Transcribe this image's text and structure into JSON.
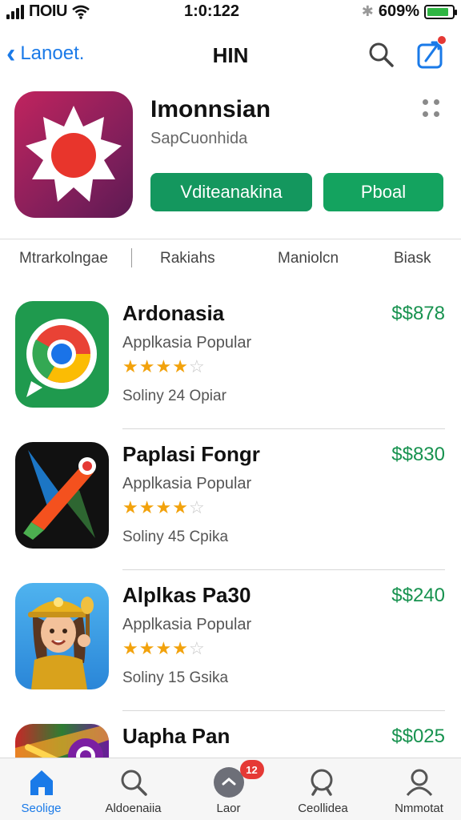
{
  "status_bar": {
    "carrier": "ПОIU",
    "time": "1:0:122",
    "battery_percent": "609%",
    "battery_level": 0.85,
    "icons": [
      "signal-icon",
      "wifi-icon",
      "bluetooth-icon",
      "battery-icon"
    ]
  },
  "nav": {
    "back_label": "Lanoet.",
    "title": "HIN",
    "icons": [
      "back-chevron-icon",
      "search-icon",
      "share-icon"
    ]
  },
  "app": {
    "name": "Imonnsian",
    "developer": "SapCuonhida",
    "primary_button": "Vditeanakina",
    "secondary_button": "Pboal",
    "accent": "#14975e"
  },
  "tabs": [
    {
      "label": "Mtrarkolngae"
    },
    {
      "label": "Rakiahs"
    },
    {
      "label": "Maniolcn"
    },
    {
      "label": "Biask"
    }
  ],
  "list": [
    {
      "title": "Ardonasia",
      "subtitle": "Applkasia Popular",
      "rating": 4,
      "meta": "Soliny 24 Opiar",
      "price": "$$878",
      "icon": "chrome-like-app-icon"
    },
    {
      "title": "Paplasi Fongr",
      "subtitle": "Applkasia Popular",
      "rating": 4,
      "meta": "Soliny 45 Cpika",
      "price": "$$830",
      "icon": "paint-brush-app-icon"
    },
    {
      "title": "Alplkas Pa30",
      "subtitle": "Applkasia Popular",
      "rating": 4,
      "meta": "Soliny 15 Gsika",
      "price": "$$240",
      "icon": "explorer-character-app-icon"
    },
    {
      "title": "Uapha Pan",
      "subtitle": "",
      "rating": 0,
      "meta": "",
      "price": "$$025",
      "icon": "colorful-app-icon"
    }
  ],
  "tab_bar": {
    "items": [
      {
        "label": "Seolige",
        "icon": "home-icon",
        "active": true
      },
      {
        "label": "Aldoenaiia",
        "icon": "search-icon",
        "active": false
      },
      {
        "label": "Laor",
        "icon": "center-hub-icon",
        "active": false,
        "badge": "12"
      },
      {
        "label": "Ceollidea",
        "icon": "search-icon",
        "active": false
      },
      {
        "label": "Nmmotat",
        "icon": "person-icon",
        "active": false
      }
    ]
  }
}
